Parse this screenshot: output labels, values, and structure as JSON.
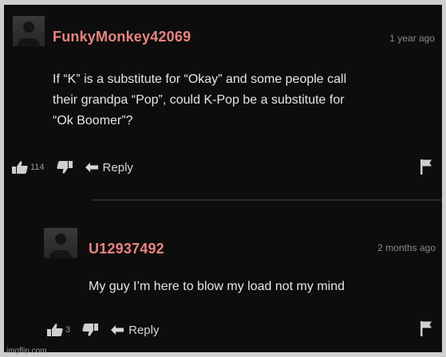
{
  "comments": [
    {
      "username": "FunkyMonkey42069",
      "timestamp": "1 year ago",
      "lines": [
        "If “K” is a substitute for “Okay” and some people call",
        "their grandpa “Pop”, could K-Pop be a substitute for",
        "“Ok Boomer”?"
      ],
      "upvotes": "114",
      "reply_label": "Reply"
    },
    {
      "username": "U12937492",
      "timestamp": "2 months ago",
      "lines": [
        "My guy I’m here to blow my load not my mind"
      ],
      "upvotes": "3",
      "reply_label": "Reply"
    }
  ],
  "watermark": "imgflip.com",
  "colors": {
    "background": "#0d0d0d",
    "username": "#e9847f",
    "text": "#e6e6e6",
    "muted": "#8a8a8a"
  },
  "icons": [
    "avatar-placeholder",
    "thumbs-up-icon",
    "thumbs-down-icon",
    "reply-arrow-icon",
    "flag-icon"
  ]
}
